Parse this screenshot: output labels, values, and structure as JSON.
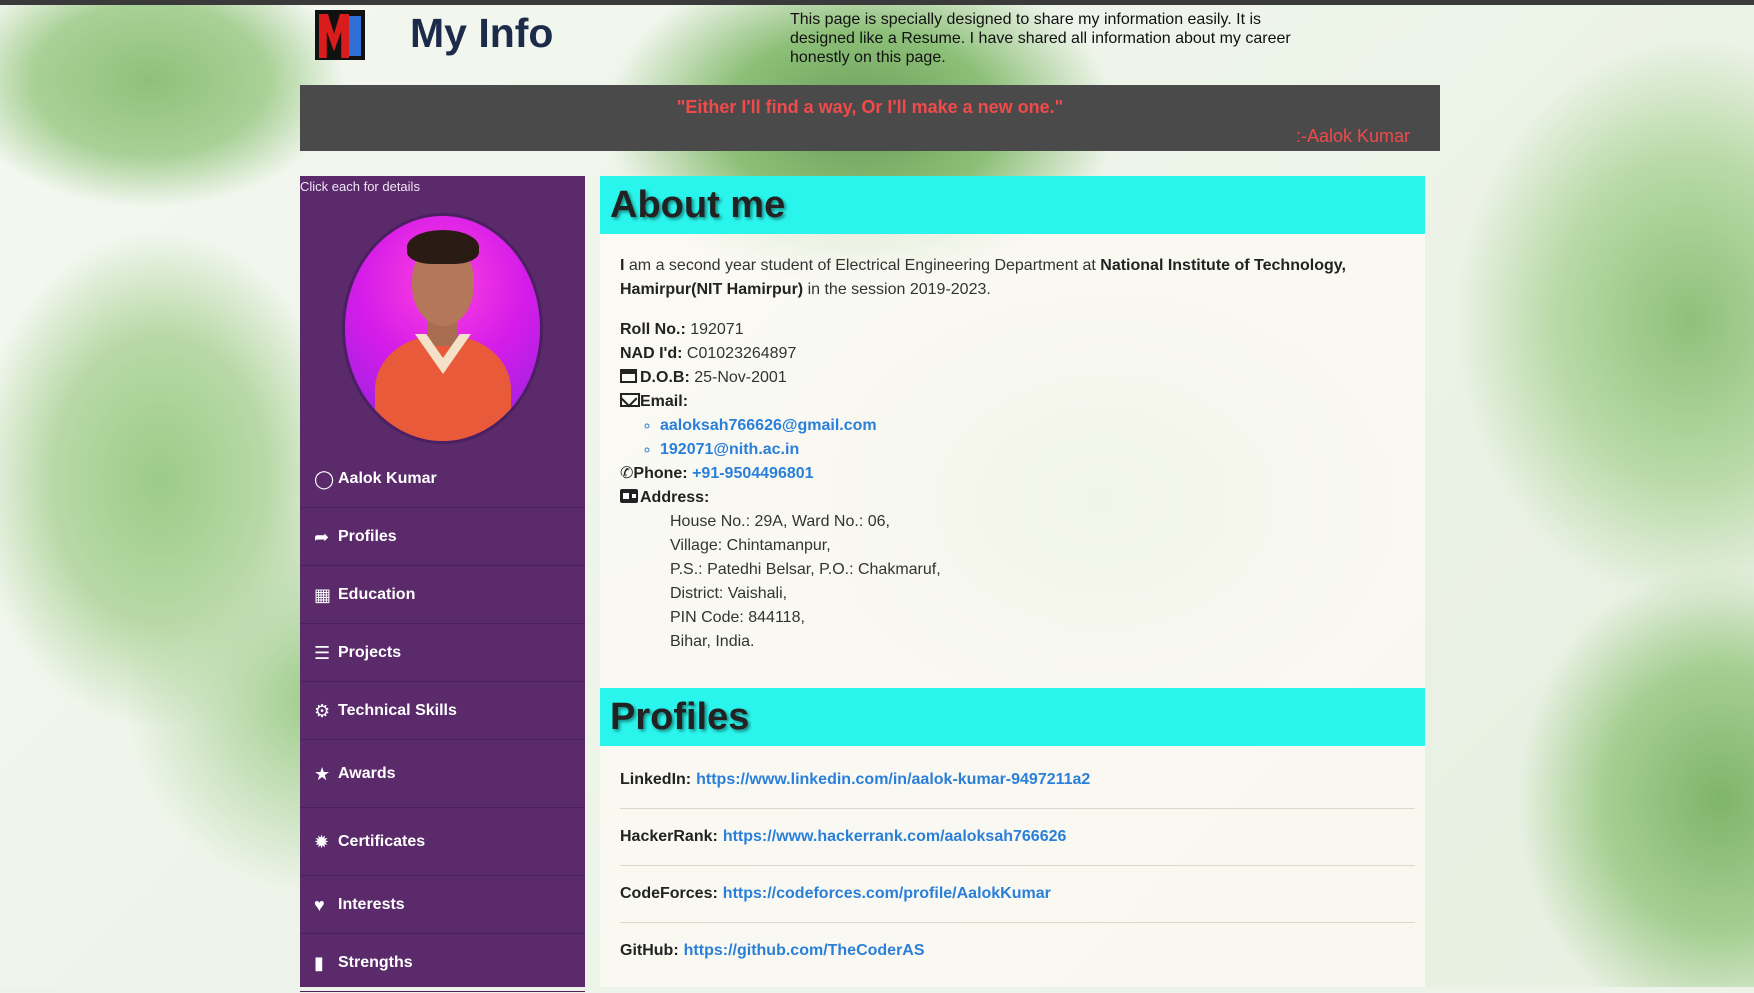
{
  "header": {
    "logo_text": "Mi",
    "title": "My Info",
    "description": "This page is specially designed to share my information easily. It is designed like a Resume. I have shared all information about my career honestly on this page."
  },
  "quote": {
    "text": "\"Either I'll find a way, Or I'll make a new one.\"",
    "author": ":-Aalok Kumar"
  },
  "sidebar": {
    "hint": "Click each for details",
    "items": [
      {
        "label": "Aalok Kumar",
        "icon": "user-circle-icon"
      },
      {
        "label": "Profiles",
        "icon": "share-arrow-icon"
      },
      {
        "label": "Education",
        "icon": "book-icon"
      },
      {
        "label": "Projects",
        "icon": "list-icon"
      },
      {
        "label": "Technical Skills",
        "icon": "gears-icon"
      },
      {
        "label": "Awards",
        "icon": "trophy-icon"
      },
      {
        "label": "Certificates",
        "icon": "certificate-icon"
      },
      {
        "label": "Interests",
        "icon": "heart-icon"
      },
      {
        "label": "Strengths",
        "icon": "strengths-icon"
      }
    ]
  },
  "about": {
    "title": "About me",
    "intro_prefix": "I",
    "intro_mid": " am a second year student of Electrical Engineering Department at ",
    "intro_bold": "National Institute of Technology, Hamirpur(NIT Hamirpur)",
    "intro_suffix": " in the session 2019-2023.",
    "roll_label": "Roll No.:",
    "roll_value": " 192071",
    "nad_label": "NAD I'd:",
    "nad_value": " C01023264897",
    "dob_label": "D.O.B:",
    "dob_value": " 25-Nov-2001",
    "email_label": "Email:",
    "emails": [
      "aaloksah766626@gmail.com",
      "192071@nith.ac.in"
    ],
    "phone_label": "Phone:",
    "phone_value": "+91-9504496801",
    "address_label": "Address:",
    "address_lines": [
      "House No.: 29A, Ward No.: 06,",
      "Village: Chintamanpur,",
      "P.S.: Patedhi Belsar, P.O.: Chakmaruf,",
      "District: Vaishali,",
      "PIN Code: 844118,",
      "Bihar, India."
    ]
  },
  "profiles": {
    "title": "Profiles",
    "items": [
      {
        "label": "LinkedIn:",
        "url": "https://www.linkedin.com/in/aalok-kumar-9497211a2"
      },
      {
        "label": "HackerRank:",
        "url": "https://www.hackerrank.com/aaloksah766626"
      },
      {
        "label": "CodeForces:",
        "url": "https://codeforces.com/profile/AalokKumar"
      },
      {
        "label": "GitHub:",
        "url": "https://github.com/TheCoderAS"
      }
    ]
  },
  "colors": {
    "sidebar_bg": "#5a2a6a",
    "section_header": "#2af5ec",
    "quote_text": "#f04a4a",
    "link": "#2a7fd8"
  }
}
